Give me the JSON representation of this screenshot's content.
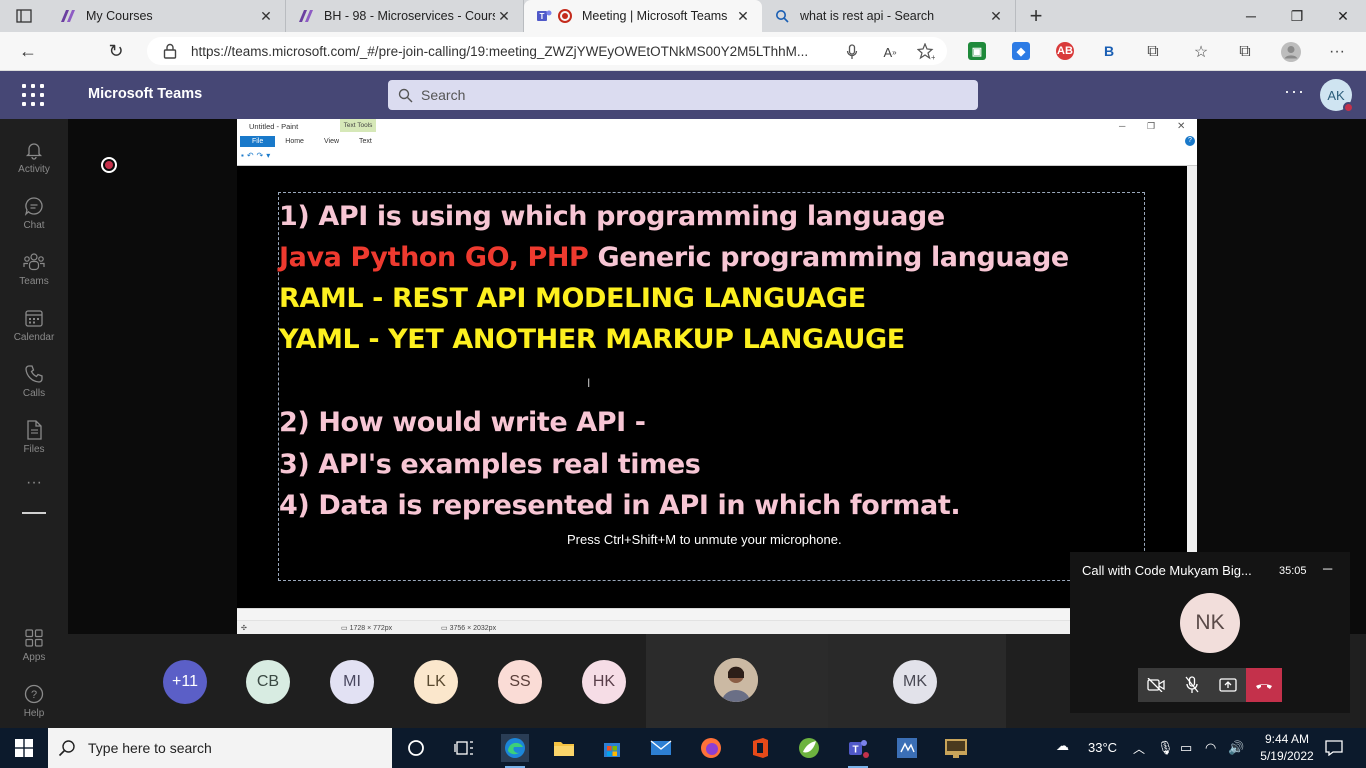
{
  "browser": {
    "tabs": [
      {
        "title": "My Courses",
        "active": false
      },
      {
        "title": "BH - 98 - Microservices - Course",
        "active": false
      },
      {
        "title": "Meeting | Microsoft Teams",
        "active": true
      },
      {
        "title": "what is rest api - Search",
        "active": false
      }
    ],
    "url": "https://teams.microsoft.com/_#/pre-join-calling/19:meeting_ZWZjYWEyOWEtOTNkMS00Y2M5LThhM..."
  },
  "teams": {
    "app_name": "Microsoft Teams",
    "search_placeholder": "Search",
    "user_initials": "AK",
    "rail": [
      {
        "label": "Activity",
        "icon": "bell-icon"
      },
      {
        "label": "Chat",
        "icon": "chat-icon"
      },
      {
        "label": "Teams",
        "icon": "teams-icon"
      },
      {
        "label": "Calendar",
        "icon": "calendar-icon"
      },
      {
        "label": "Calls",
        "icon": "phone-icon"
      },
      {
        "label": "Files",
        "icon": "file-icon"
      },
      {
        "label": "Apps",
        "icon": "apps-icon"
      },
      {
        "label": "Help",
        "icon": "help-icon"
      }
    ],
    "rail_more": "···"
  },
  "paint": {
    "title": "Untitled - Paint",
    "contextual_tab": "Text Tools",
    "menu": [
      "File",
      "Home",
      "View",
      "Text"
    ],
    "status_selection": "1728 × 772px",
    "status_canvas": "3756 × 2032px",
    "lines": [
      {
        "text": "1) API is using which programming language",
        "color": "pink"
      },
      {
        "text_red": "Java Python GO, PHP ",
        "text_pink": "Generic programming language"
      },
      {
        "text": "RAML  - REST API MODELING LANGUAGE",
        "color": "yellow"
      },
      {
        "text": "YAML - YET ANOTHER MARKUP LANGAUGE",
        "color": "yellow"
      },
      {
        "text": "2) How would write API  -",
        "color": "pink"
      },
      {
        "text": "3) API's examples real times",
        "color": "pink"
      },
      {
        "text": "4) Data is represented in API in which format.",
        "color": "pink"
      }
    ]
  },
  "meeting": {
    "mute_hint": "Press Ctrl+Shift+M to unmute your microphone.",
    "participants": [
      {
        "initials": "+11",
        "color": "#5b5fc7",
        "text_color": "#ffffff"
      },
      {
        "initials": "CB",
        "color": "#d8ece2",
        "text_color": "#3b4a44"
      },
      {
        "initials": "MI",
        "color": "#e2e1f3",
        "text_color": "#4a4860"
      },
      {
        "initials": "LK",
        "color": "#fbe7cc",
        "text_color": "#5a4a30"
      },
      {
        "initials": "SS",
        "color": "#fadcd6",
        "text_color": "#5a3f3a"
      },
      {
        "initials": "HK",
        "color": "#f6dde6",
        "text_color": "#5a3f4a"
      },
      {
        "initials": "MK",
        "color": "#e2e2ea",
        "text_color": "#4a4a55"
      }
    ],
    "call_window": {
      "title": "Call with Code Mukyam Big...",
      "duration": "35:05",
      "avatar_initials": "NK"
    }
  },
  "taskbar": {
    "search_placeholder": "Type here to search",
    "weather": "33°C",
    "time": "9:44 AM",
    "date": "5/19/2022"
  }
}
